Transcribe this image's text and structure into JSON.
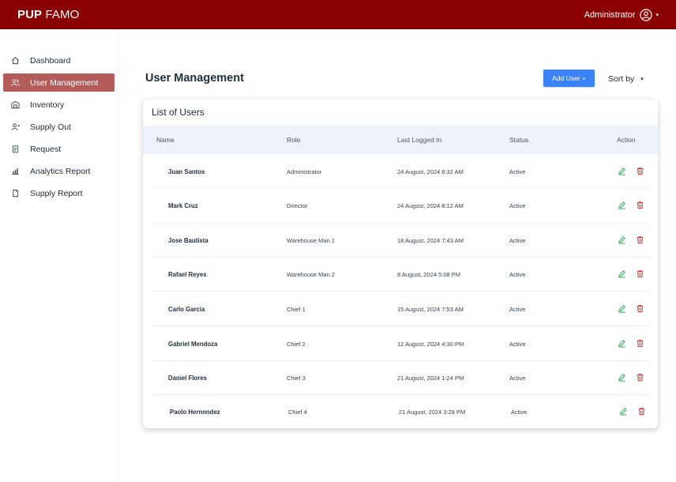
{
  "header": {
    "brand_bold": "PUP",
    "brand_rest": "FAMO",
    "user_name": "Administrator",
    "caret": "▾"
  },
  "sidebar": {
    "items": [
      {
        "label": "Dashboard",
        "icon": "home-icon"
      },
      {
        "label": "User Management",
        "icon": "users-icon",
        "active": true
      },
      {
        "label": "Inventory",
        "icon": "warehouse-icon"
      },
      {
        "label": "Supply Out",
        "icon": "user-out-icon"
      },
      {
        "label": "Request",
        "icon": "clipboard-icon"
      },
      {
        "label": "Analytics Report",
        "icon": "bar-chart-icon"
      },
      {
        "label": "Supply Report",
        "icon": "document-icon"
      }
    ]
  },
  "main": {
    "title": "User Management",
    "add_button": "Add User +",
    "sort_label": "Sort by",
    "sort_caret": "▾"
  },
  "table": {
    "title": "List of Users",
    "headers": [
      "Name",
      "Role",
      "Last Logged In",
      "Status",
      "Action"
    ],
    "rows": [
      {
        "name": "Juan Santos",
        "role": "Administrator",
        "last_login": "24 August, 2024 8:32 AM",
        "status": "Active"
      },
      {
        "name": "Mark Cruz",
        "role": "Director",
        "last_login": "24 August, 2024 8:12 AM",
        "status": "Active"
      },
      {
        "name": "Jose Bautista",
        "role": "Warehouse Man 1",
        "last_login": "18 August, 2024 7:43 AM",
        "status": "Active"
      },
      {
        "name": "Rafael Reyes",
        "role": "Warehouse Man 2",
        "last_login": "8 August, 2024 5:08 PM",
        "status": "Active"
      },
      {
        "name": "Carlo Garcia",
        "role": "Chief 1",
        "last_login": "15 August, 2024 7:53 AM",
        "status": "Active"
      },
      {
        "name": "Gabriel Mendoza",
        "role": "Chief 2",
        "last_login": "12 August, 2024 4:30 PM",
        "status": "Active"
      },
      {
        "name": "Daniel Flores",
        "role": "Chief 3",
        "last_login": "21 August, 2024 1:24 PM",
        "status": "Active"
      },
      {
        "name": "Paolo Hernnndez",
        "role": "Chief 4",
        "last_login": "21 August, 2024 3:28 PM",
        "status": "Active"
      }
    ]
  },
  "colors": {
    "topbar": "#8b0000",
    "active_nav": "#b45c59",
    "primary_button": "#3b82f6",
    "edit_icon": "#22a34a",
    "delete_icon": "#dc2626"
  }
}
